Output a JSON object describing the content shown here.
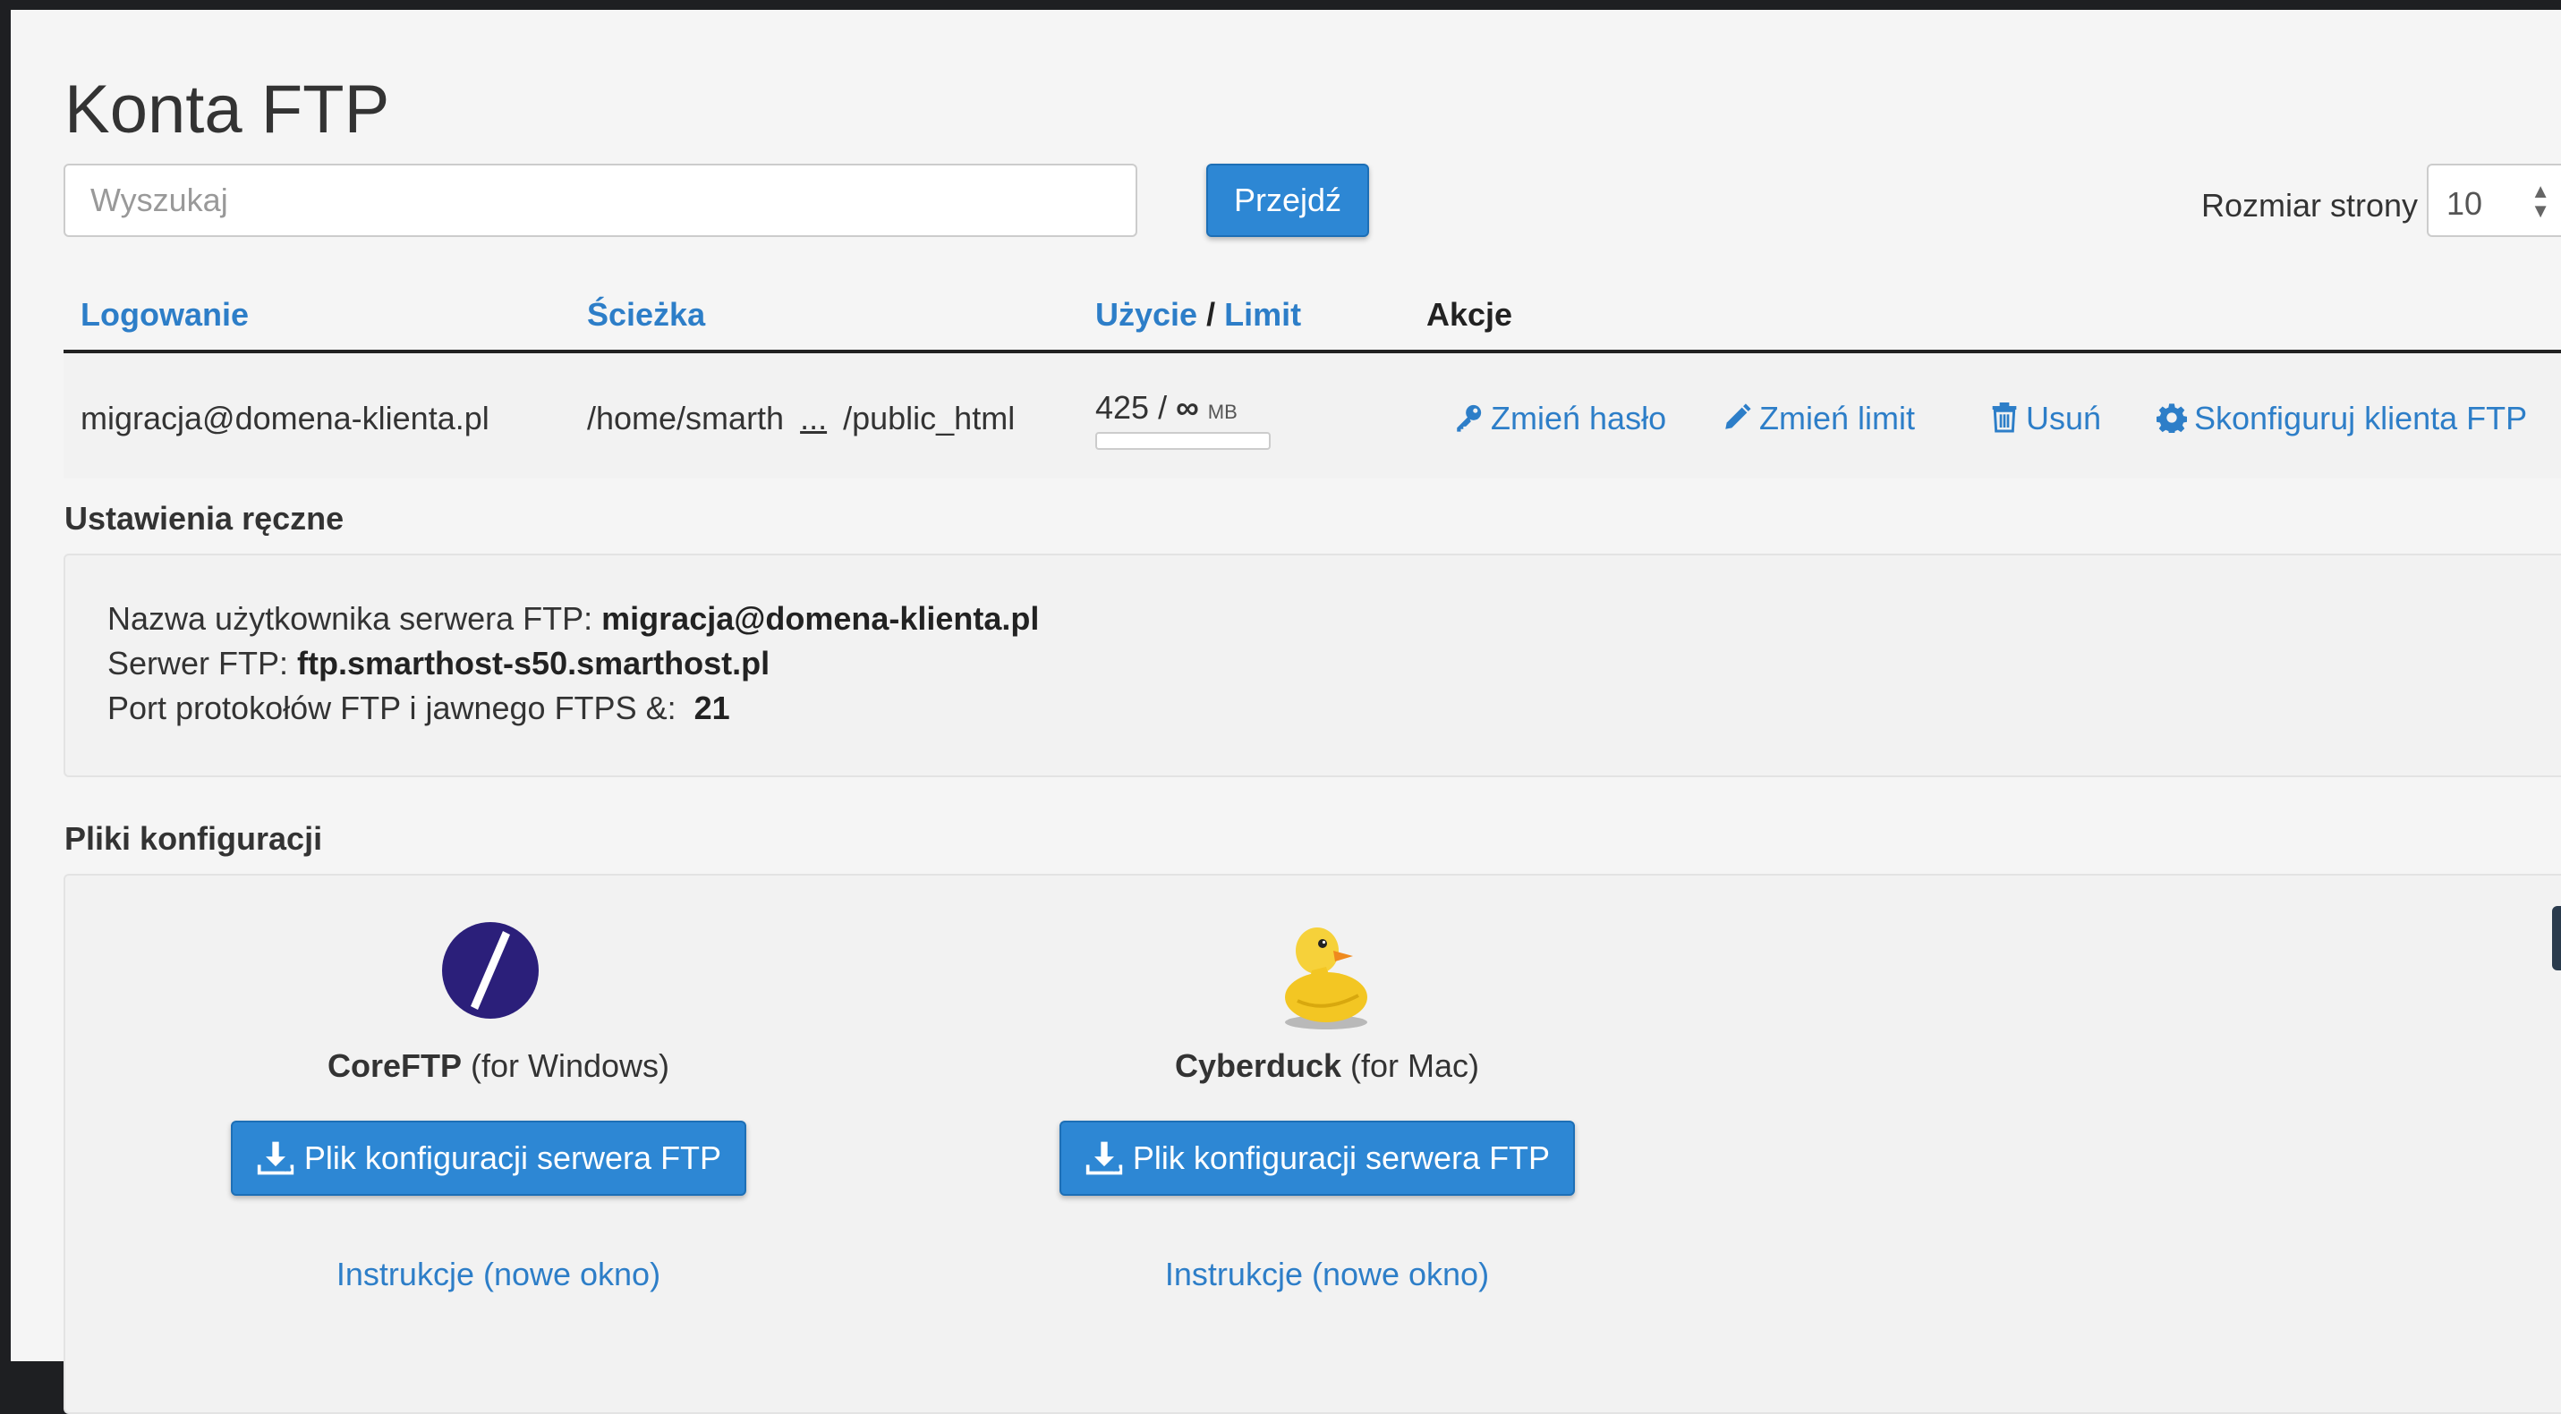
{
  "page": {
    "title": "Konta FTP"
  },
  "search": {
    "placeholder": "Wyszukaj",
    "button_label": "Przejdź"
  },
  "page_size": {
    "label": "Rozmiar strony",
    "value": "10"
  },
  "table": {
    "headers": {
      "login": "Logowanie",
      "path": "Ścieżka",
      "usage": "Użycie",
      "sep": " / ",
      "limit": "Limit",
      "actions": "Akcje"
    },
    "rows": [
      {
        "login": "migracja@domena-klienta.pl",
        "path_start": "/home/smarth",
        "path_ellipsis": "...",
        "path_end": "/public_html",
        "usage": "425",
        "usage_sep": " / ",
        "limit": "∞",
        "unit": "MB",
        "usage_fraction": 0
      }
    ],
    "actions": {
      "change_password": "Zmień hasło",
      "change_limit": "Zmień limit",
      "delete": "Usuń",
      "configure": "Skonfiguruj klienta FTP"
    }
  },
  "manual_settings": {
    "title": "Ustawienia ręczne",
    "username_label": "Nazwa użytkownika serwera FTP: ",
    "username_value": "migracja@domena-klienta.pl",
    "server_label": "Serwer FTP: ",
    "server_value": "ftp.smarthost-s50.smarthost.pl",
    "port_label": "Port protokołów FTP i jawnego FTPS &:",
    "port_value": "21"
  },
  "config_files": {
    "title": "Pliki konfiguracji",
    "clients": [
      {
        "name": "CoreFTP",
        "platform": " (for Windows)",
        "button_label": "Plik konfiguracji serwera FTP",
        "link_label": "Instrukcje (nowe okno)",
        "logo": "coreftp-logo",
        "color": "#2b1f7a"
      },
      {
        "name": "Cyberduck",
        "platform": " (for Mac)",
        "button_label": "Plik konfiguracji serwera FTP",
        "link_label": "Instrukcje (nowe okno)",
        "logo": "cyberduck-logo",
        "color": "#f3c623"
      }
    ]
  },
  "colors": {
    "accent": "#2d87d4",
    "link": "#2d7ec8",
    "text": "#333333"
  }
}
